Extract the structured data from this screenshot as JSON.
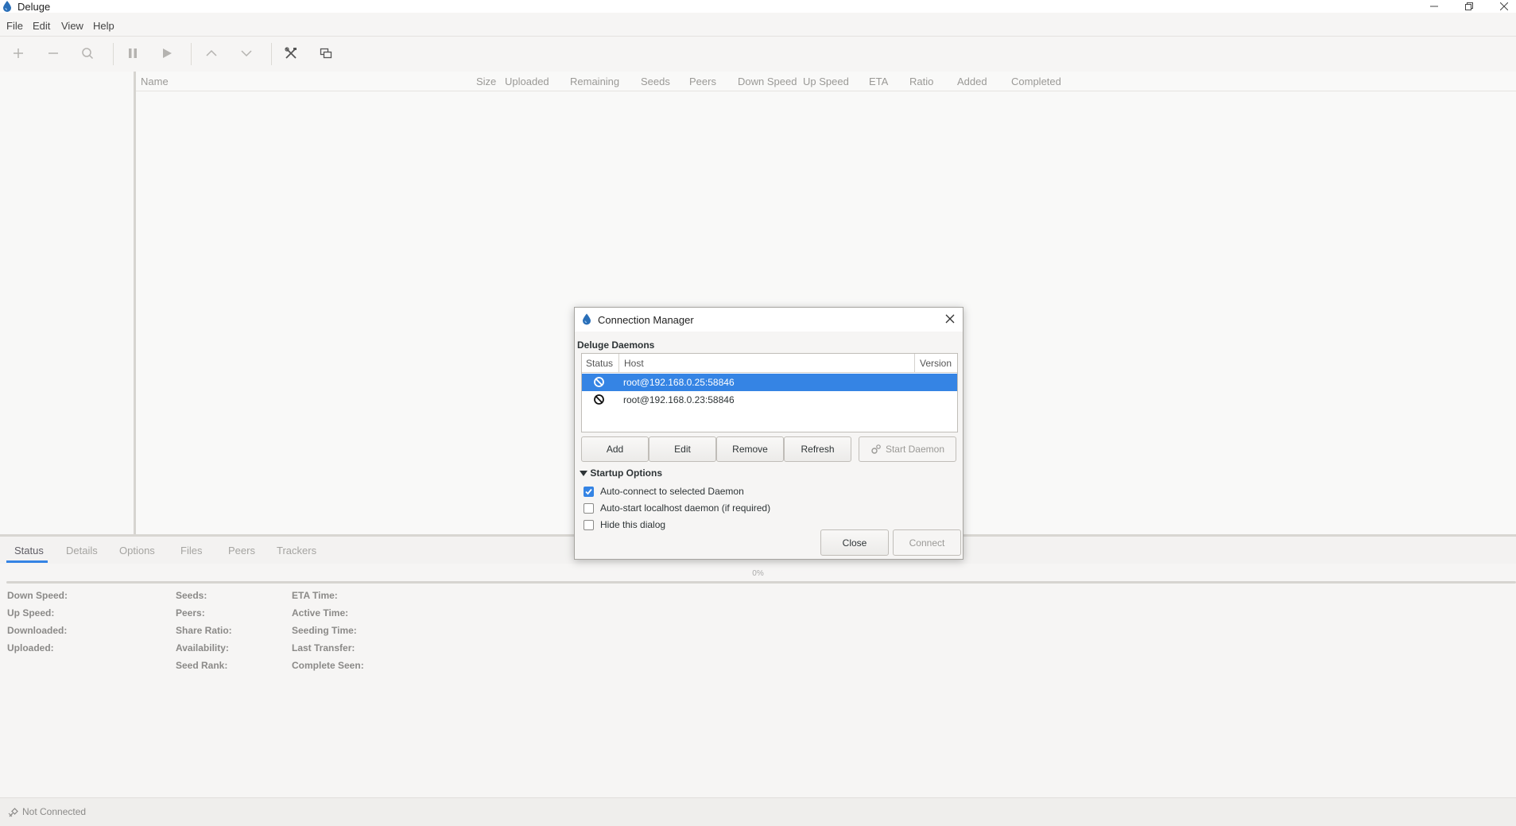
{
  "window": {
    "title": "Deluge"
  },
  "menu": [
    "File",
    "Edit",
    "View",
    "Help"
  ],
  "torrent_list": {
    "columns": [
      "Name",
      "Size",
      "Uploaded",
      "Remaining",
      "Seeds",
      "Peers",
      "Down Speed",
      "Up Speed",
      "ETA",
      "Ratio",
      "Added",
      "Completed"
    ]
  },
  "tabs": [
    "Status",
    "Details",
    "Options",
    "Files",
    "Peers",
    "Trackers"
  ],
  "progress": {
    "text": "0%",
    "fraction": 0
  },
  "details": {
    "col1": [
      "Down Speed:",
      "Up Speed:",
      "Downloaded:",
      "Uploaded:"
    ],
    "col2": [
      "Seeds:",
      "Peers:",
      "Share Ratio:",
      "Availability:",
      "Seed Rank:"
    ],
    "col3": [
      "ETA Time:",
      "Active Time:",
      "Seeding Time:",
      "Last Transfer:",
      "Complete Seen:"
    ]
  },
  "statusbar": {
    "text": "Not Connected"
  },
  "dialog": {
    "title": "Connection Manager",
    "section": "Deluge Daemons",
    "headers": {
      "status": "Status",
      "host": "Host",
      "version": "Version"
    },
    "hosts": [
      {
        "host": "root@192.168.0.25:58846",
        "selected": true
      },
      {
        "host": "root@192.168.0.23:58846",
        "selected": false
      }
    ],
    "buttons": {
      "add": "Add",
      "edit": "Edit",
      "remove": "Remove",
      "refresh": "Refresh",
      "start_daemon": "Start Daemon",
      "close": "Close",
      "connect": "Connect"
    },
    "startup_options": {
      "label": "Startup Options",
      "autoconnect": {
        "label": "Auto-connect to selected Daemon",
        "checked": true
      },
      "autostart": {
        "label": "Auto-start localhost daemon (if required)",
        "checked": false
      },
      "hide": {
        "label": "Hide this dialog",
        "checked": false
      }
    }
  },
  "colors": {
    "accent": "#3584e4",
    "background": "#f6f5f4"
  }
}
